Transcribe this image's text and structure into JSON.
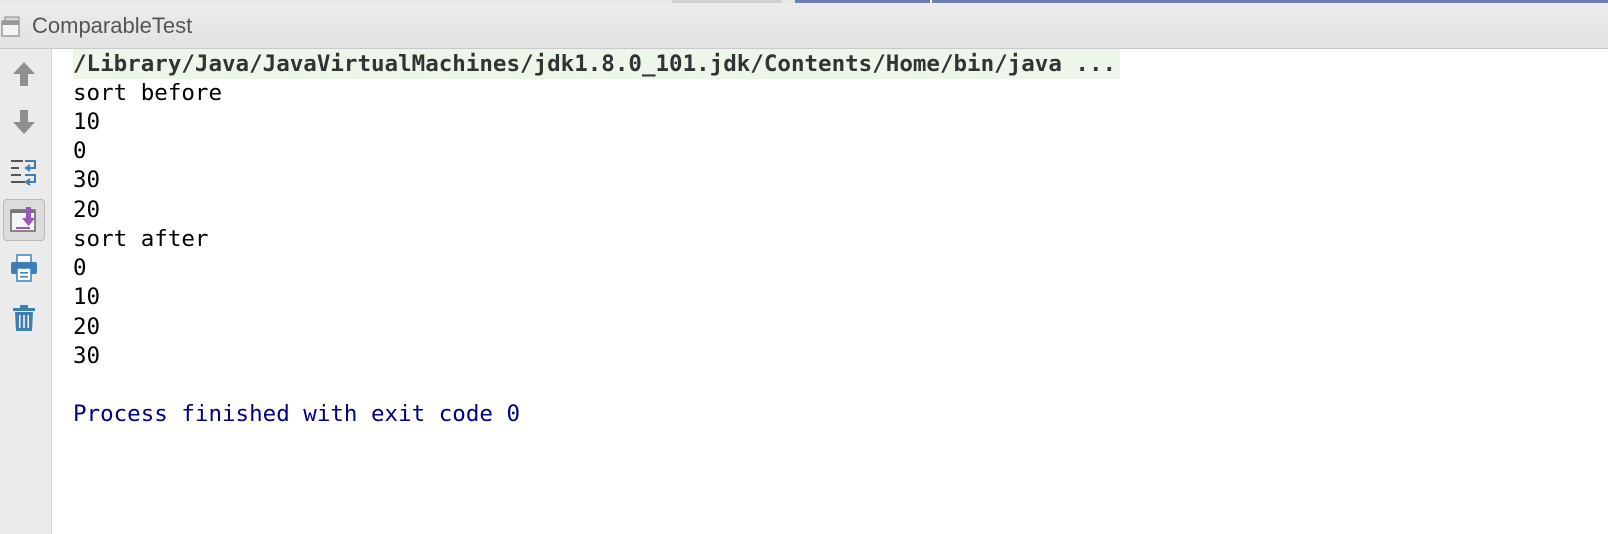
{
  "header": {
    "title": "ComparableTest"
  },
  "toolbar": {
    "buttons": [
      {
        "name": "up-arrow-icon",
        "label": "Up to previous occurrence"
      },
      {
        "name": "down-arrow-icon",
        "label": "Down to next occurrence"
      },
      {
        "name": "soft-wrap-icon",
        "label": "Soft wrap"
      },
      {
        "name": "scroll-to-end-icon",
        "label": "Scroll to end"
      },
      {
        "name": "print-icon",
        "label": "Print"
      },
      {
        "name": "trash-icon",
        "label": "Clear all"
      }
    ]
  },
  "console": {
    "command": "/Library/Java/JavaVirtualMachines/jdk1.8.0_101.jdk/Contents/Home/bin/java ...",
    "output_lines": [
      "sort before",
      "10",
      "0",
      "30",
      "20",
      "sort after",
      "0",
      "10",
      "20",
      "30"
    ],
    "exit_message": "Process finished with exit code 0"
  },
  "colors": {
    "command_highlight": "#ecf7ea",
    "exit_text": "#000080",
    "icon_blue": "#3d7fb5",
    "icon_gray": "#8a8a8a",
    "icon_purple": "#9b59b6"
  }
}
